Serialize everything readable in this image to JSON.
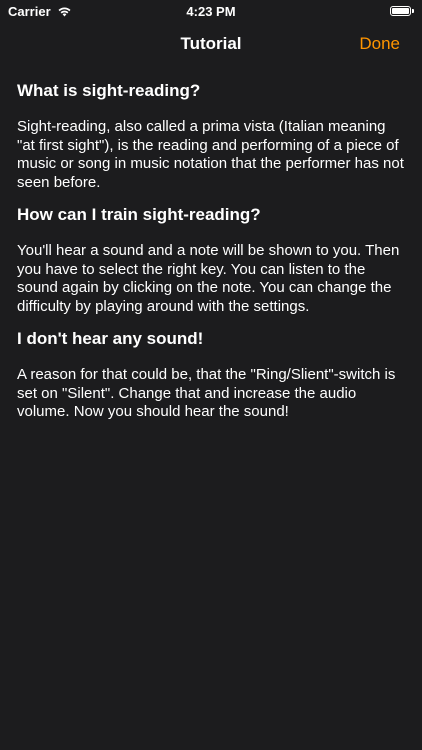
{
  "status_bar": {
    "carrier": "Carrier",
    "time": "4:23 PM"
  },
  "nav": {
    "title": "Tutorial",
    "done_label": "Done"
  },
  "sections": [
    {
      "title": "What is sight-reading?",
      "text": "Sight-reading, also called a prima vista (Italian meaning \"at first sight\"), is the reading and performing of a piece of music or song in music notation that the performer has not seen before."
    },
    {
      "title": "How can I train sight-reading?",
      "text": "You'll hear a sound and a note will be shown to you. Then you have to select the right key. You can listen to the sound again by clicking on the note. You can change the difficulty by playing around with the settings."
    },
    {
      "title": "I don't hear any sound!",
      "text": "A reason for that could be, that the \"Ring/Slient\"-switch is set on \"Silent\". Change that and increase the audio volume. Now you should hear the sound!"
    }
  ],
  "colors": {
    "background": "#1c1c1e",
    "accent": "#ff9500",
    "text": "#ffffff"
  }
}
